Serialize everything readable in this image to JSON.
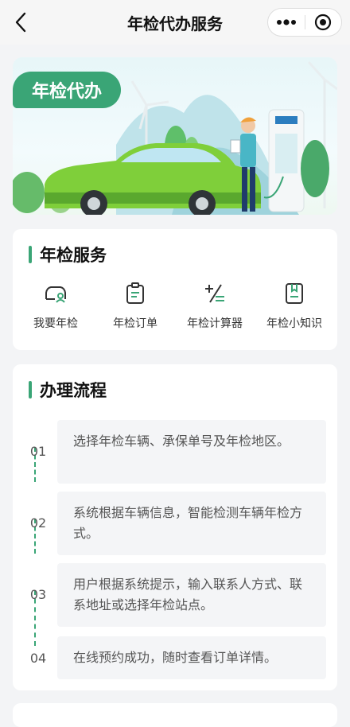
{
  "header": {
    "title": "年检代办服务"
  },
  "banner": {
    "tag": "年检代办"
  },
  "services_card": {
    "title": "年检服务",
    "items": [
      {
        "label": "我要年检",
        "icon": "car-user-icon"
      },
      {
        "label": "年检订单",
        "icon": "clipboard-icon"
      },
      {
        "label": "年检计算器",
        "icon": "calculator-icon"
      },
      {
        "label": "年检小知识",
        "icon": "bookmark-doc-icon"
      }
    ]
  },
  "process_card": {
    "title": "办理流程",
    "steps": [
      {
        "num": "01",
        "text": "选择年检车辆、承保单号及年检地区。"
      },
      {
        "num": "02",
        "text": "系统根据车辆信息，智能检测车辆年检方式。"
      },
      {
        "num": "03",
        "text": "用户根据系统提示，输入联系人方式、联系地址或选择年检站点。"
      },
      {
        "num": "04",
        "text": "在线预约成功，随时查看订单详情。"
      }
    ]
  },
  "colors": {
    "accent": "#3aa576",
    "background": "#f3f4f6"
  }
}
